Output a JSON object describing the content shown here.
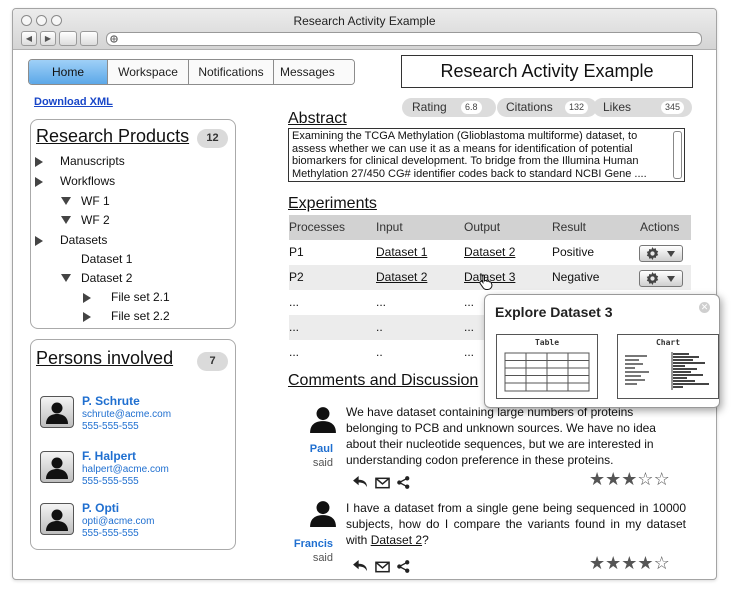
{
  "window": {
    "title": "Research Activity Example"
  },
  "browser": {
    "back": "◀",
    "forward": "▶",
    "url_icon": "globe-icon"
  },
  "nav": {
    "tabs": [
      {
        "label": "Home",
        "active": true
      },
      {
        "label": "Workspace"
      },
      {
        "label": "Notifications"
      },
      {
        "label": "Messages"
      }
    ]
  },
  "page_title": "Research Activity Example",
  "download_xml": "Download XML",
  "research_products": {
    "title": "Research Products",
    "count": "12",
    "items": [
      {
        "label": "Manuscripts",
        "state": "collapsed"
      },
      {
        "label": "Workflows",
        "state": "collapsed"
      },
      {
        "label": "WF 1",
        "state": "expanded"
      },
      {
        "label": "WF 2",
        "state": "expanded"
      },
      {
        "label": "Datasets",
        "state": "collapsed"
      },
      {
        "label": "Dataset 1",
        "state": "leaf"
      },
      {
        "label": "Dataset 2",
        "state": "expanded"
      },
      {
        "label": "File set 2.1",
        "state": "collapsed"
      },
      {
        "label": "File set 2.2",
        "state": "collapsed"
      }
    ]
  },
  "persons": {
    "title": "Persons involved",
    "count": "7",
    "list": [
      {
        "name": "P. Schrute",
        "email": "schrute@acme.com",
        "phone": "555-555-555"
      },
      {
        "name": "F. Halpert",
        "email": "halpert@acme.com",
        "phone": "555-555-555"
      },
      {
        "name": "P. Opti",
        "email": "opti@acme.com",
        "phone": "555-555-555"
      }
    ]
  },
  "metrics": {
    "rating_label": "Rating",
    "rating_value": "6.8",
    "citations_label": "Citations",
    "citations_value": "132",
    "likes_label": "Likes",
    "likes_value": "345"
  },
  "abstract": {
    "title": "Abstract",
    "text": "Examining the TCGA Methylation (Glioblastoma multiforme) dataset, to assess whether we can use it as a means for identification of potential biomarkers for clinical development. To bridge from the Illumina Human Methylation 27/450 CG# identifier codes back to standard NCBI Gene ...."
  },
  "experiments": {
    "title": "Experiments",
    "headers": [
      "Processes",
      "Input",
      "Output",
      "Result",
      "Actions"
    ],
    "rows": [
      {
        "process": "P1",
        "input": "Dataset 1",
        "output": "Dataset 2",
        "result": "Positive"
      },
      {
        "process": "P2",
        "input": "Dataset 2",
        "output": "Dataset 3",
        "result": "Negative"
      },
      {
        "process": "...",
        "input": "...",
        "output": "...",
        "result": ""
      },
      {
        "process": "...",
        "input": "..",
        "output": "...",
        "result": ""
      },
      {
        "process": "...",
        "input": "..",
        "output": "...",
        "result": ""
      }
    ]
  },
  "popup": {
    "title": "Explore Dataset 3",
    "table_label": "Table",
    "chart_label": "Chart"
  },
  "comments": {
    "title": "Comments and Discussion",
    "items": [
      {
        "author": "Paul",
        "said": "said",
        "text": "We have dataset containing large numbers of proteins belonging to PCB  and unknown sources. We have no idea about their nucleotide sequences, but we are interested in understanding codon preference in these proteins.",
        "rating": 3
      },
      {
        "author": "Francis",
        "said": "said",
        "text_before": "I have a dataset from a single gene being sequenced in 10000 subjects, how do I compare the variants found in my dataset with ",
        "link": "Dataset 2",
        "text_after": "?",
        "rating": 4
      }
    ]
  },
  "colors": {
    "accent": "#5ca8e8",
    "link": "#1846c8",
    "person": "#1f6fd0"
  }
}
